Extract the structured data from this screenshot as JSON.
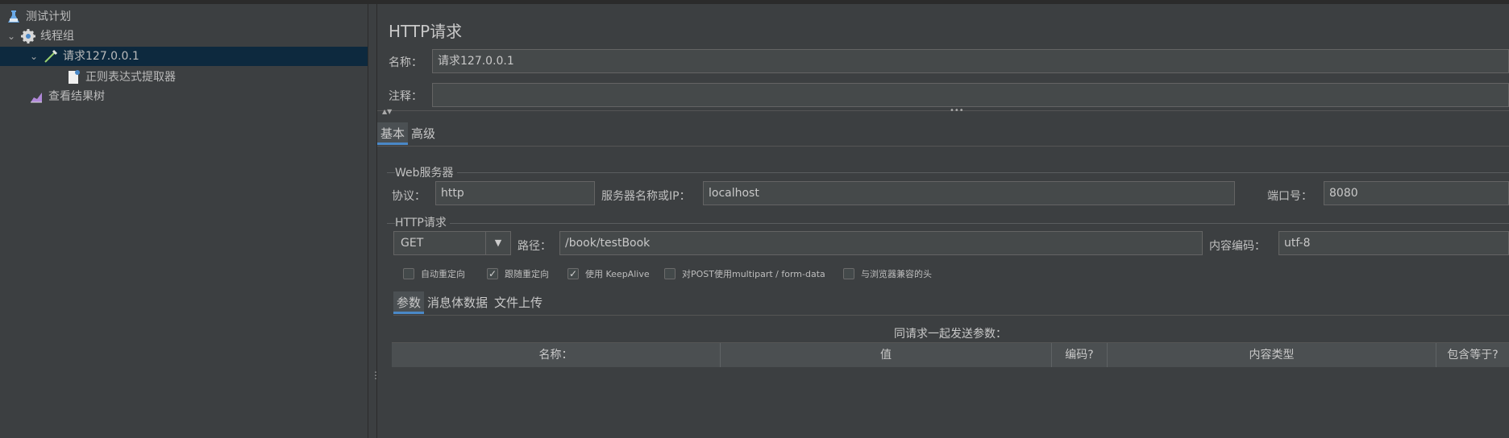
{
  "tree": {
    "items": [
      {
        "label": "测试计划",
        "icon": "flask-icon"
      },
      {
        "label": "线程组",
        "icon": "gear-icon"
      },
      {
        "label": "请求127.0.0.1",
        "icon": "pipette-icon"
      },
      {
        "label": "正则表达式提取器",
        "icon": "document-icon"
      },
      {
        "label": "查看结果树",
        "icon": "chart-icon"
      }
    ]
  },
  "panel": {
    "title": "HTTP请求",
    "name_label": "名称：",
    "name_value": "请求127.0.0.1",
    "comment_label": "注释：",
    "comment_value": ""
  },
  "tabs": {
    "basic": "基本",
    "advanced": "高级"
  },
  "web_server": {
    "group_title": "Web服务器",
    "protocol_label": "协议：",
    "protocol_value": "http",
    "server_label": "服务器名称或IP：",
    "server_value": "localhost",
    "port_label": "端口号：",
    "port_value": "8080"
  },
  "http_request": {
    "group_title": "HTTP请求",
    "method": "GET",
    "path_label": "路径：",
    "path_value": "/book/testBook",
    "encoding_label": "内容编码：",
    "encoding_value": "utf-8"
  },
  "options": [
    {
      "label": "自动重定向",
      "checked": false
    },
    {
      "label": "跟随重定向",
      "checked": true
    },
    {
      "label": "使用 KeepAlive",
      "checked": true
    },
    {
      "label": "对POST使用multipart / form-data",
      "checked": false
    },
    {
      "label": "与浏览器兼容的头",
      "checked": false
    }
  ],
  "subtabs": {
    "params": "参数",
    "body": "消息体数据",
    "upload": "文件上传"
  },
  "params_caption": "同请求一起发送参数：",
  "table_headers": [
    "名称：",
    "值",
    "编码?",
    "内容类型",
    "包含等于?"
  ],
  "colors": {
    "selection": "#0d293e",
    "tab_accent": "#4a88c7",
    "bg": "#3c3f41"
  }
}
